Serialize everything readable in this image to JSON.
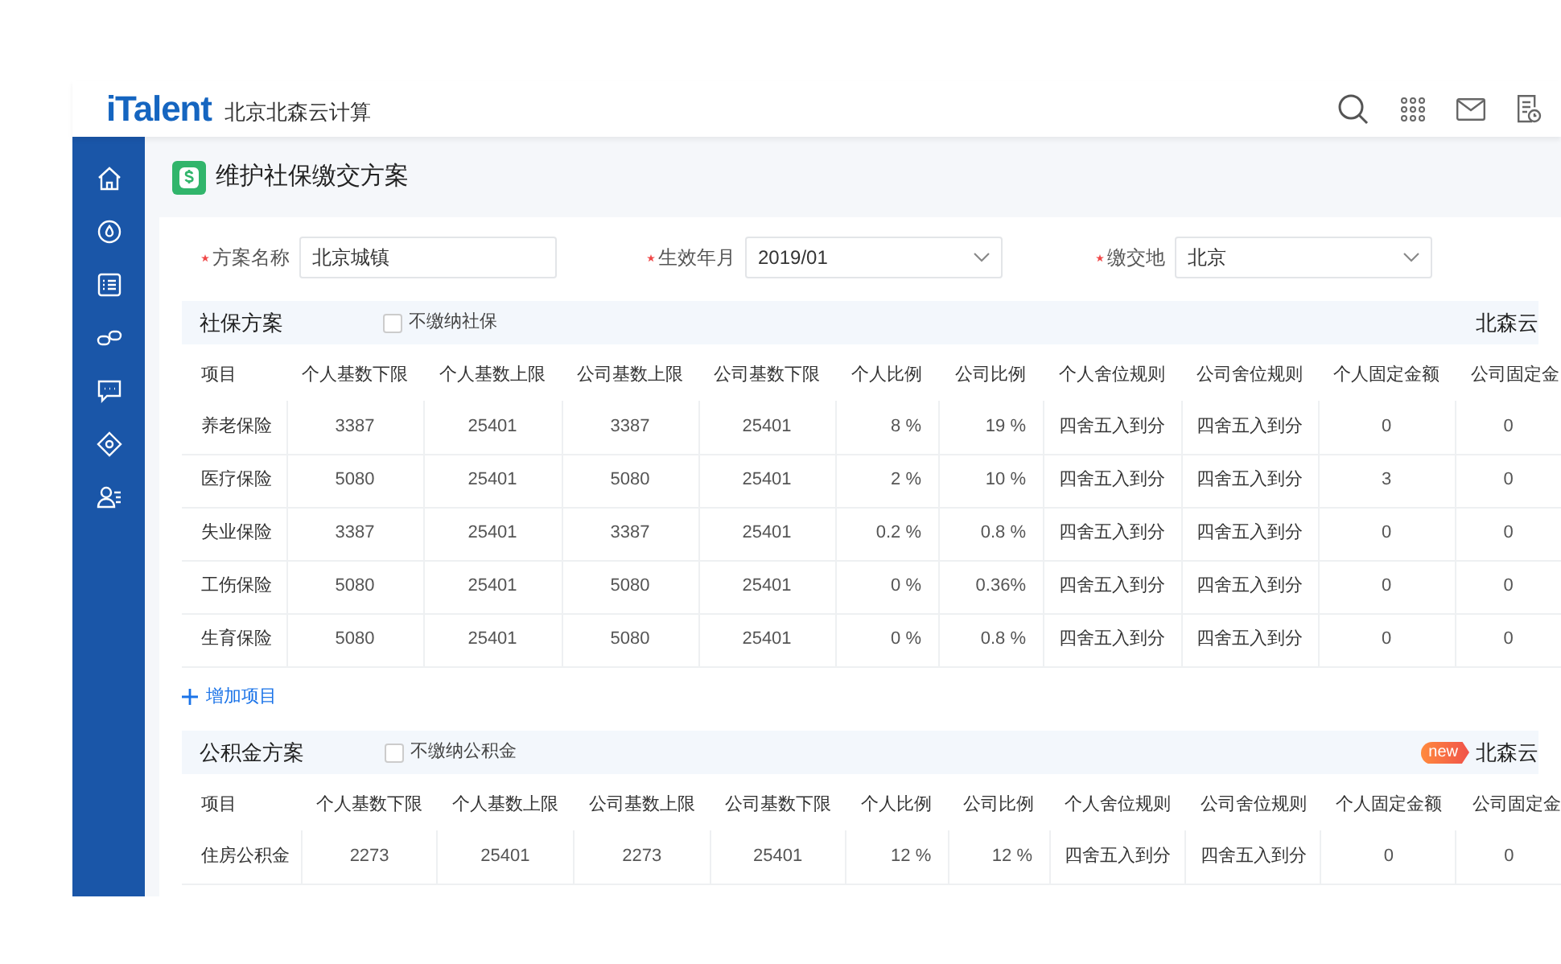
{
  "header": {
    "logo": "iTalent",
    "company": "北京北森云计算"
  },
  "page_title": "维护社保缴交方案",
  "form": [
    {
      "kind": "text",
      "label": "方案名称",
      "required": true,
      "value": "北京城镇"
    },
    {
      "kind": "select",
      "label": "生效年月",
      "required": true,
      "value": "2019/01"
    },
    {
      "kind": "select",
      "label": "缴交地",
      "required": true,
      "value": "北京"
    }
  ],
  "sections": [
    {
      "title": "社保方案",
      "checkbox": {
        "label": "不缴纳社保",
        "checked": false
      },
      "right_text": "北森云",
      "columns": [
        {
          "label": "项目",
          "kind": "name"
        },
        {
          "label": "个人基数下限",
          "kind": "number"
        },
        {
          "label": "个人基数上限",
          "kind": "number"
        },
        {
          "label": "公司基数上限",
          "kind": "number"
        },
        {
          "label": "公司基数下限",
          "kind": "number"
        },
        {
          "label": "个人比例",
          "kind": "percent"
        },
        {
          "label": "公司比例",
          "kind": "percent"
        },
        {
          "label": "个人舍位规则",
          "kind": "rule"
        },
        {
          "label": "公司舍位规则",
          "kind": "rule"
        },
        {
          "label": "个人固定金额",
          "kind": "number"
        },
        {
          "label": "公司固定金",
          "kind": "number"
        }
      ],
      "rows": [
        [
          "养老保险",
          "3387",
          "25401",
          "3387",
          "25401",
          "8 %",
          "19 %",
          "四舍五入到分",
          "四舍五入到分",
          "0",
          "0"
        ],
        [
          "医疗保险",
          "5080",
          "25401",
          "5080",
          "25401",
          "2 %",
          "10 %",
          "四舍五入到分",
          "四舍五入到分",
          "3",
          "0"
        ],
        [
          "失业保险",
          "3387",
          "25401",
          "3387",
          "25401",
          "0.2 %",
          "0.8 %",
          "四舍五入到分",
          "四舍五入到分",
          "0",
          "0"
        ],
        [
          "工伤保险",
          "5080",
          "25401",
          "5080",
          "25401",
          "0 %",
          "0.36%",
          "四舍五入到分",
          "四舍五入到分",
          "0",
          "0"
        ],
        [
          "生育保险",
          "5080",
          "25401",
          "5080",
          "25401",
          "0 %",
          "0.8 %",
          "四舍五入到分",
          "四舍五入到分",
          "0",
          "0"
        ]
      ],
      "add_button": "增加项目"
    },
    {
      "title": "公积金方案",
      "checkbox": {
        "label": "不缴纳公积金",
        "checked": false
      },
      "badge": "new",
      "right_text": "北森云",
      "columns": [
        {
          "label": "项目",
          "kind": "name"
        },
        {
          "label": "个人基数下限",
          "kind": "number"
        },
        {
          "label": "个人基数上限",
          "kind": "number"
        },
        {
          "label": "公司基数上限",
          "kind": "number"
        },
        {
          "label": "公司基数下限",
          "kind": "number"
        },
        {
          "label": "个人比例",
          "kind": "percent"
        },
        {
          "label": "公司比例",
          "kind": "percent"
        },
        {
          "label": "个人舍位规则",
          "kind": "rule"
        },
        {
          "label": "公司舍位规则",
          "kind": "rule"
        },
        {
          "label": "个人固定金额",
          "kind": "number"
        },
        {
          "label": "公司固定金",
          "kind": "number"
        }
      ],
      "rows": [
        [
          "住房公积金",
          "2273",
          "25401",
          "2273",
          "25401",
          "12 %",
          "12 %",
          "四舍五入到分",
          "四舍五入到分",
          "0",
          "0"
        ]
      ]
    }
  ]
}
